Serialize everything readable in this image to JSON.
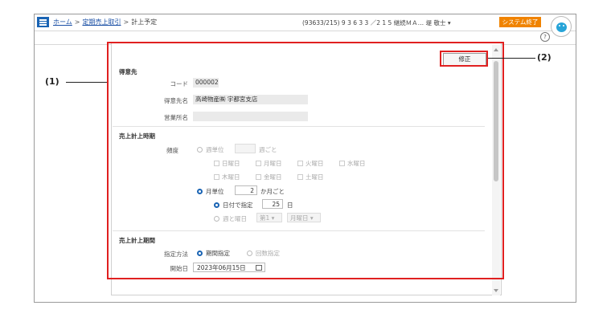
{
  "header": {
    "breadcrumb": {
      "home": "ホーム",
      "sep": ">",
      "parent": "定期売上取引",
      "current": "計上予定"
    },
    "user_info": "(93633/215) 9 3 6 3 3 ／2 1 5 継続ＭＡ… 堤 敬士 ▾",
    "system_exit": "システム終了",
    "help": "?"
  },
  "form": {
    "edit_button": "修正",
    "customer": {
      "title": "得意先",
      "code_label": "コード",
      "code_value": "000002",
      "name_label": "得意先名",
      "name_value": "高崎物産㈱ 宇都宮支店",
      "office_label": "営業所名",
      "office_value": ""
    },
    "timing": {
      "title": "売上計上時期",
      "freq_label": "頻度",
      "weekly": "週単位",
      "weekly_suffix": "週ごと",
      "weekly_value": "",
      "days": [
        "日曜日",
        "月曜日",
        "火曜日",
        "水曜日",
        "木曜日",
        "金曜日",
        "土曜日"
      ],
      "monthly": "月単位",
      "monthly_value": "2",
      "monthly_suffix": "か月ごと",
      "by_date": "日付で指定",
      "date_value": "25",
      "date_suffix": "日",
      "by_week": "週と曜日",
      "week_select": "第1 ▾",
      "weekday_select": "月曜日 ▾"
    },
    "period": {
      "title": "売上計上期間",
      "method_label": "指定方法",
      "by_period": "期間指定",
      "by_count": "回数指定",
      "start_label": "開始日",
      "start_value": "2023年06月15日"
    }
  },
  "callouts": {
    "one": "(1)",
    "two": "(2)"
  }
}
